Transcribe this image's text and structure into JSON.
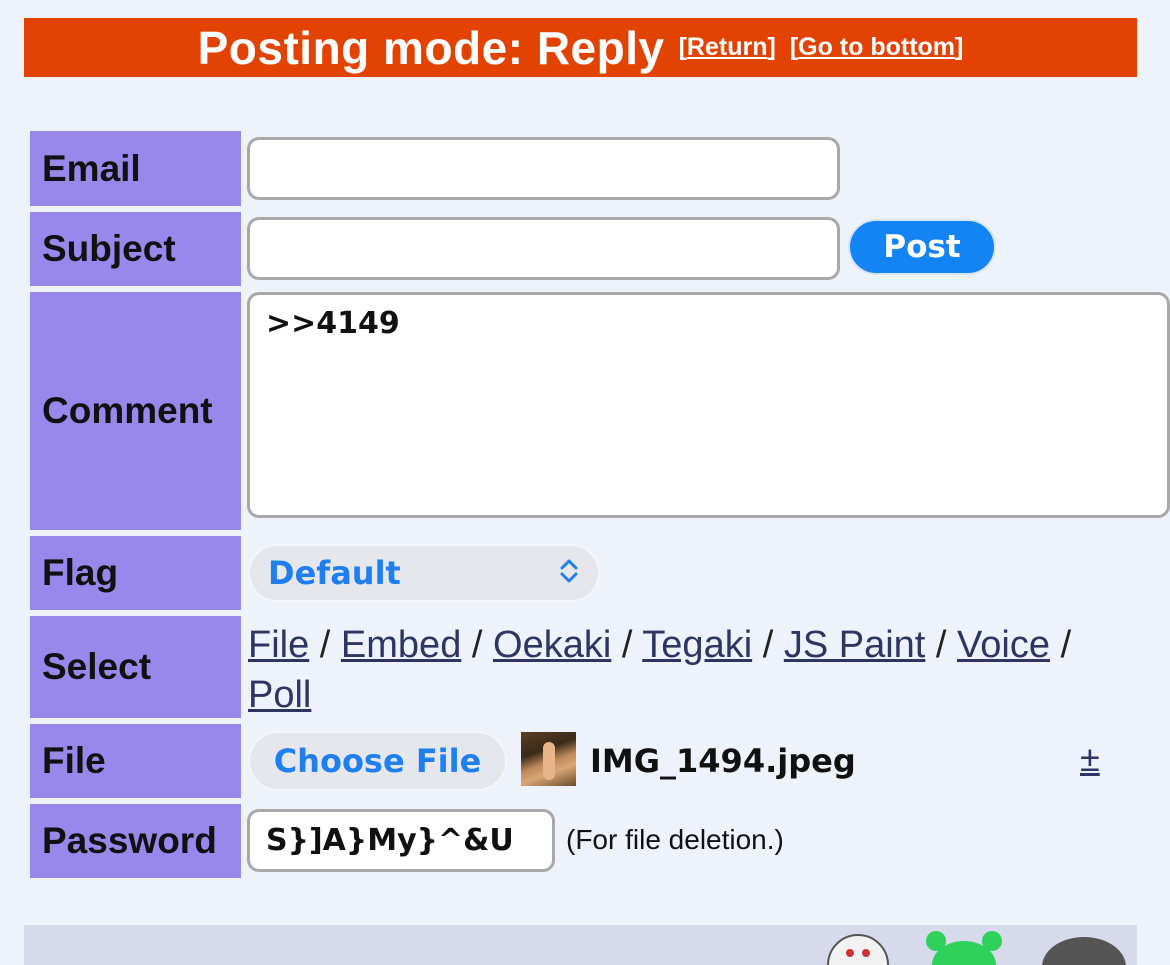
{
  "banner": {
    "title": "Posting mode: Reply",
    "return_link": "Return",
    "bottom_link": "Go to bottom"
  },
  "form": {
    "email": {
      "label": "Email",
      "value": ""
    },
    "subject": {
      "label": "Subject",
      "value": "",
      "post_button": "Post"
    },
    "comment": {
      "label": "Comment",
      "value": ">>4149"
    },
    "flag": {
      "label": "Flag",
      "selected": "Default"
    },
    "select": {
      "label": "Select",
      "options": [
        "File",
        "Embed",
        "Oekaki",
        "Tegaki",
        "JS Paint",
        "Voice",
        "Poll"
      ]
    },
    "file": {
      "label": "File",
      "choose_button": "Choose File",
      "filename": "IMG_1494.jpeg",
      "toggle": "±"
    },
    "password": {
      "label": "Password",
      "value": "S}]A}My}^&U",
      "note": "(For file deletion.)"
    }
  },
  "colors": {
    "banner_bg": "#e24303",
    "label_bg": "#9988ec",
    "page_bg": "#eef2fb",
    "accent_blue": "#1484f5"
  },
  "icons": {
    "flag_select": "chevron-up-down-icon",
    "file_thumbnail": "image-thumbnail-icon"
  }
}
